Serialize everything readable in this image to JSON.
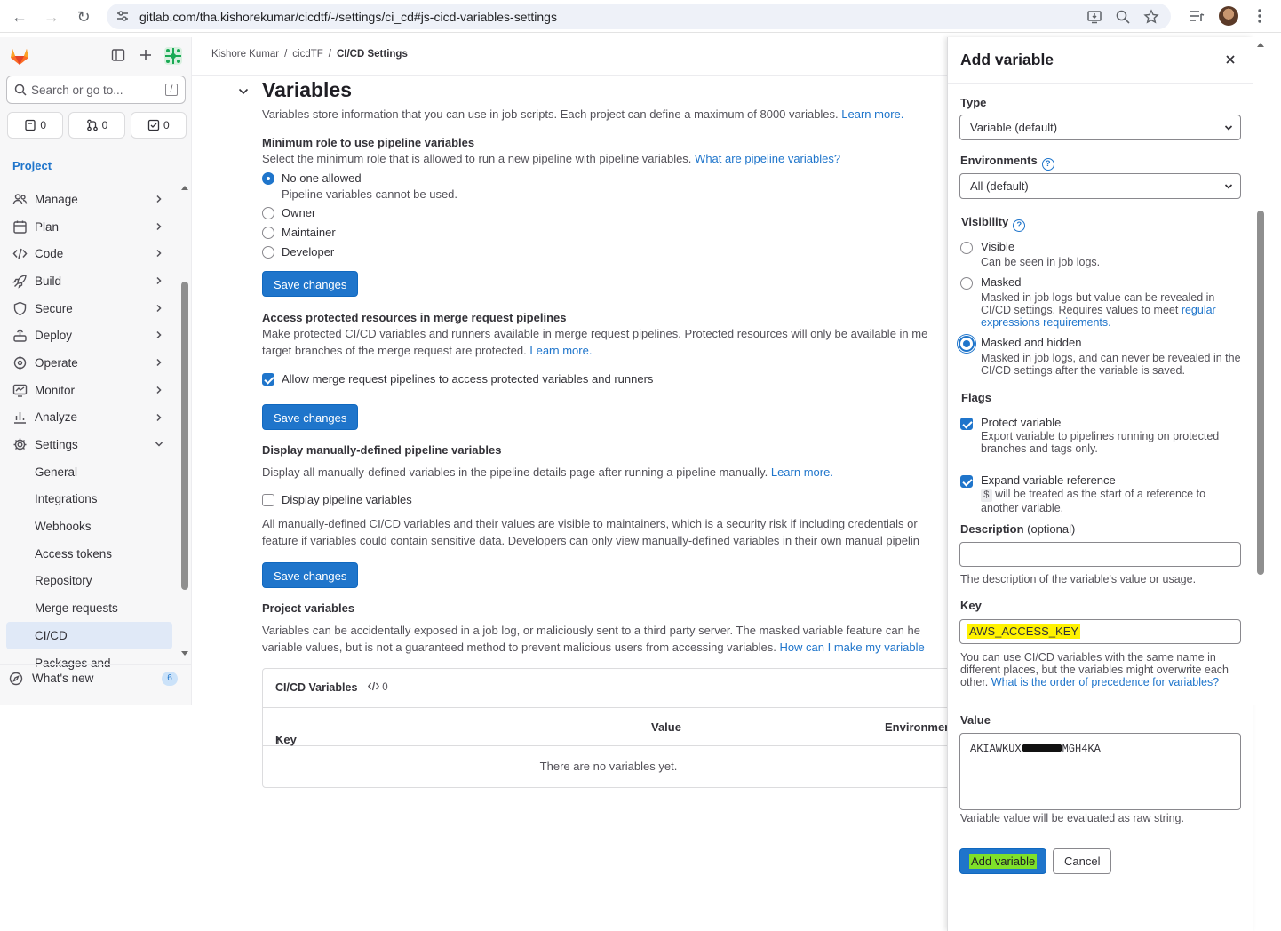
{
  "browser": {
    "url": "gitlab.com/tha.kishorekumar/cicdtf/-/settings/ci_cd#js-cicd-variables-settings"
  },
  "sidebar": {
    "search_placeholder": "Search or go to...",
    "search_shortcut": "/",
    "counters": {
      "issues": "0",
      "merge_requests": "0",
      "todos": "0"
    },
    "context_label": "Project",
    "items": [
      {
        "label": "Manage",
        "icon": "users-icon"
      },
      {
        "label": "Plan",
        "icon": "calendar-icon"
      },
      {
        "label": "Code",
        "icon": "code-icon"
      },
      {
        "label": "Build",
        "icon": "rocket-icon"
      },
      {
        "label": "Secure",
        "icon": "shield-icon"
      },
      {
        "label": "Deploy",
        "icon": "deploy-icon"
      },
      {
        "label": "Operate",
        "icon": "cloud-icon"
      },
      {
        "label": "Monitor",
        "icon": "monitor-icon"
      },
      {
        "label": "Analyze",
        "icon": "chart-icon"
      },
      {
        "label": "Settings",
        "icon": "gear-icon"
      }
    ],
    "settings_sub": [
      "General",
      "Integrations",
      "Webhooks",
      "Access tokens",
      "Repository",
      "Merge requests",
      "CI/CD",
      "Packages and"
    ],
    "whats_new": "What's new",
    "whats_new_count": "6"
  },
  "breadcrumb": {
    "user": "Kishore Kumar",
    "project": "cicdTF",
    "page": "CI/CD Settings",
    "sep": "/"
  },
  "main": {
    "title": "Variables",
    "intro": "Variables store information that you can use in job scripts. Each project can define a maximum of 8000 variables.",
    "learn_more": "Learn more.",
    "min_role": {
      "heading": "Minimum role to use pipeline variables",
      "desc": "Select the minimum role that is allowed to run a new pipeline with pipeline variables.",
      "desc_link": "What are pipeline variables?",
      "options": [
        "No one allowed",
        "Owner",
        "Maintainer",
        "Developer"
      ],
      "no_one_desc": "Pipeline variables cannot be used."
    },
    "save_label": "Save changes",
    "access": {
      "heading": "Access protected resources in merge request pipelines",
      "desc1": "Make protected CI/CD variables and runners available in merge request pipelines. Protected resources will only be available in me",
      "desc2": "target branches of the merge request are protected.",
      "checkbox": "Allow merge request pipelines to access protected variables and runners"
    },
    "display_manual": {
      "heading": "Display manually-defined pipeline variables",
      "desc": "Display all manually-defined variables in the pipeline details page after running a pipeline manually.",
      "checkbox": "Display pipeline variables",
      "warn1": "All manually-defined CI/CD variables and their values are visible to maintainers, which is a security risk if including credentials or",
      "warn2": "feature if variables could contain sensitive data. Developers can only view manually-defined variables in their own manual pipelin"
    },
    "project_vars": {
      "heading": "Project variables",
      "desc1": "Variables can be accidentally exposed in a job log, or maliciously sent to a third party server. The masked variable feature can he",
      "desc2": "variable values, but is not a guaranteed method to prevent malicious users from accessing variables.",
      "desc2_link": "How can I make my variable",
      "card_title": "CI/CD Variables",
      "card_count": "0",
      "col_key": "Key",
      "col_value": "Value",
      "col_env": "Environmen",
      "empty": "There are no variables yet."
    }
  },
  "drawer": {
    "title": "Add variable",
    "type_label": "Type",
    "type_value": "Variable (default)",
    "env_label": "Environments",
    "env_value": "All (default)",
    "visibility_label": "Visibility",
    "visibility": [
      {
        "label": "Visible",
        "desc": "Can be seen in job logs."
      },
      {
        "label": "Masked",
        "desc": "Masked in job logs but value can be revealed in CI/CD settings. Requires values to meet",
        "link": "regular expressions requirements."
      },
      {
        "label": "Masked and hidden",
        "desc": "Masked in job logs, and can never be revealed in the CI/CD settings after the variable is saved."
      }
    ],
    "flags_label": "Flags",
    "protect_label": "Protect variable",
    "protect_desc": "Export variable to pipelines running on protected branches and tags only.",
    "expand_label": "Expand variable reference",
    "expand_code": "$",
    "expand_desc": "will be treated as the start of a reference to another variable.",
    "desc_label": "Description",
    "desc_optional": "(optional)",
    "desc_value": "",
    "desc_help": "The description of the variable's value or usage.",
    "key_label": "Key",
    "key_value": "AWS_ACCESS_KEY",
    "key_help": "You can use CI/CD variables with the same name in different places, but the variables might overwrite each other.",
    "key_help_link": "What is the order of precedence for variables?",
    "value_label": "Value",
    "value_prefix": "AKIAWKUX",
    "value_suffix": "MGH4KA",
    "value_help": "Variable value will be evaluated as raw string.",
    "add_label": "Add variable",
    "cancel_label": "Cancel"
  },
  "colors": {
    "link": "#1f75cb",
    "primary": "#1f75cb",
    "highlight_key": "#fff200",
    "highlight_button": "#7fe02a"
  }
}
